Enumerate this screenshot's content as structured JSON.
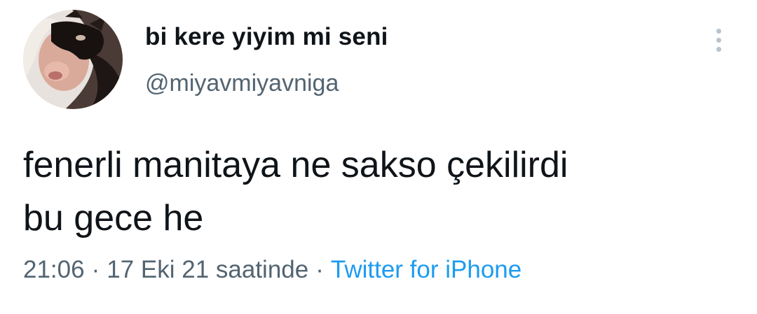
{
  "tweet": {
    "author": {
      "display_name": "bi kere yiyim mi seni",
      "handle": "@miyavmiyavniga",
      "avatar_icon": "profile-photo"
    },
    "text_line_1": "fenerli manitaya ne sakso çekilirdi",
    "text_line_2": "bu gece he",
    "meta": {
      "time": "21:06",
      "separator": "·",
      "date": "17 Eki 21 saatinde",
      "source": "Twitter for iPhone"
    },
    "more_icon": "more-options-vertical"
  },
  "colors": {
    "text": "#0f1419",
    "secondary": "#536471",
    "link": "#1d9bf0",
    "background": "#ffffff"
  }
}
